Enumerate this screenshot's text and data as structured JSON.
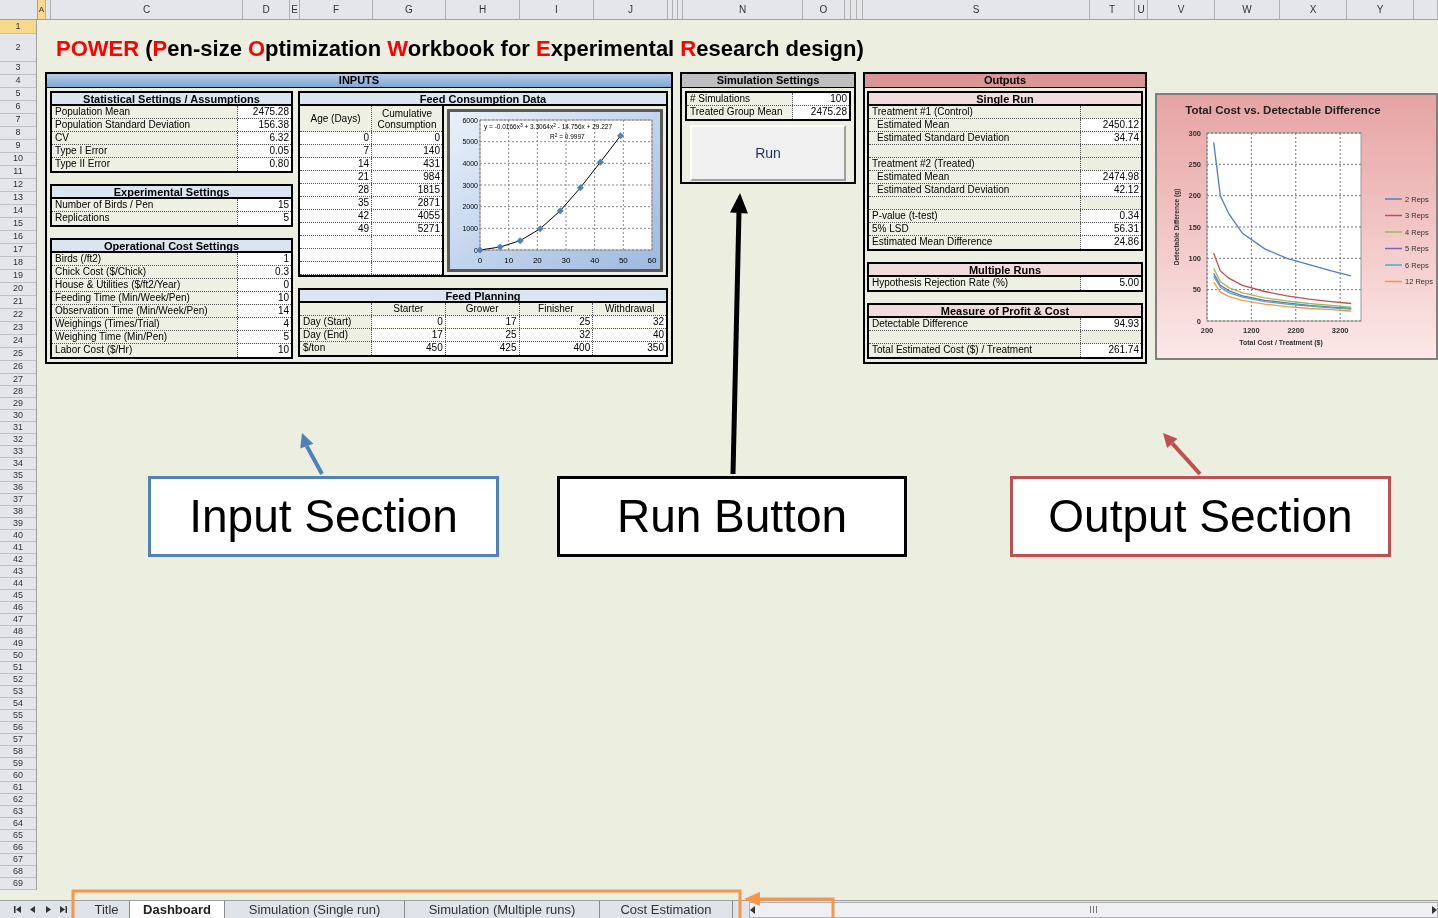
{
  "column_headers": [
    "A",
    "C",
    "D",
    "E",
    "F",
    "G",
    "H",
    "I",
    "J",
    "N",
    "O",
    "S",
    "T",
    "U",
    "V",
    "W",
    "X",
    "Y"
  ],
  "row_headers": [
    "1",
    "2",
    "3",
    "4",
    "5",
    "6",
    "7",
    "8",
    "9",
    "10",
    "11",
    "12",
    "13",
    "14",
    "15",
    "16",
    "17",
    "18",
    "19",
    "20",
    "21",
    "22",
    "23",
    "24",
    "25",
    "26",
    "27",
    "28",
    "29",
    "30",
    "31",
    "32",
    "33",
    "34",
    "35",
    "36",
    "37",
    "38",
    "39",
    "40",
    "41",
    "42",
    "43",
    "44",
    "45",
    "46",
    "47",
    "48",
    "49",
    "50",
    "51",
    "52",
    "53",
    "54",
    "55",
    "56",
    "57",
    "58",
    "59",
    "60",
    "61",
    "62",
    "63",
    "64",
    "65",
    "66",
    "67",
    "68",
    "69"
  ],
  "title": [
    {
      "text": "P",
      "accent": true
    },
    {
      "text": "OWER",
      "accent": true
    },
    {
      "text": " (",
      "accent": false
    },
    {
      "text": "P",
      "accent": true
    },
    {
      "text": "en-size ",
      "accent": false
    },
    {
      "text": "O",
      "accent": true
    },
    {
      "text": "ptimization ",
      "accent": false
    },
    {
      "text": "W",
      "accent": true
    },
    {
      "text": "orkbook for ",
      "accent": false
    },
    {
      "text": "E",
      "accent": true
    },
    {
      "text": "xperimental ",
      "accent": false
    },
    {
      "text": "R",
      "accent": true
    },
    {
      "text": "esearch design)",
      "accent": false
    }
  ],
  "inputs": {
    "title": "INPUTS",
    "tables": [
      {
        "title": "Statistical Settings / Assumptions",
        "rows": [
          {
            "label": "Population Mean",
            "value": "2475.28"
          },
          {
            "label": "Population Standard Deviation",
            "value": "156.38"
          },
          {
            "label": "CV",
            "value": "6.32"
          },
          {
            "label": "Type I Error",
            "value": "0.05"
          },
          {
            "label": "Type II Error",
            "value": "0.80"
          }
        ]
      },
      {
        "title": "Experimental Settings",
        "rows": [
          {
            "label": "Number of Birds / Pen",
            "value": "15"
          },
          {
            "label": "Replications",
            "value": "5"
          }
        ]
      },
      {
        "title": "Operational Cost Settings",
        "rows": [
          {
            "label": "Birds (/ft2)",
            "value": "1"
          },
          {
            "label": "Chick Cost ($/Chick)",
            "value": "0.3"
          },
          {
            "label": "House & Utilities ($/ft2/Year)",
            "value": "0"
          },
          {
            "label": "Feeding Time (Min/Week/Pen)",
            "value": "10"
          },
          {
            "label": "Observation Time (Min/Week/Pen)",
            "value": "14"
          },
          {
            "label": "Weighings (Times/Trial)",
            "value": "4"
          },
          {
            "label": "Weighing Time (Min/Pen)",
            "value": "5"
          },
          {
            "label": "Labor Cost ($/Hr)",
            "value": "10"
          }
        ]
      }
    ],
    "feed_consumption": {
      "title": "Feed Consumption Data",
      "columns": [
        "Age (Days)",
        "Cumulative Consumption"
      ],
      "rows": [
        [
          "0",
          "0"
        ],
        [
          "7",
          "140"
        ],
        [
          "14",
          "431"
        ],
        [
          "21",
          "984"
        ],
        [
          "28",
          "1815"
        ],
        [
          "35",
          "2871"
        ],
        [
          "42",
          "4055"
        ],
        [
          "49",
          "5271"
        ]
      ],
      "chart_data": {
        "type": "line",
        "grid": true,
        "x": [
          0,
          7,
          14,
          21,
          28,
          35,
          42,
          49
        ],
        "series": [
          {
            "color": "#4f81bd",
            "marker": "diamond",
            "values": [
              0,
              140,
              431,
              984,
              1815,
              2871,
              4055,
              5271
            ]
          }
        ],
        "xlim": [
          0,
          60
        ],
        "ylim": [
          0,
          6000
        ],
        "xticks": [
          0,
          10,
          20,
          30,
          40,
          50,
          60
        ],
        "yticks": [
          0,
          1000,
          2000,
          3000,
          4000,
          5000,
          6000
        ],
        "annotations": [
          "y = -0.0166x$^{3}$ + 3.3064x$^{2}$ - 14.756x + 29.227",
          "R$^{2}$ = 0.9997"
        ]
      }
    },
    "feed_planning": {
      "title": "Feed Planning",
      "columns": [
        "Starter",
        "Grower",
        "Finisher",
        "Withdrawal"
      ],
      "rows": [
        {
          "label": "Day (Start)",
          "values": [
            "0",
            "17",
            "25",
            "32"
          ]
        },
        {
          "label": "Day (End)",
          "values": [
            "17",
            "25",
            "32",
            "40"
          ]
        },
        {
          "label": "$/ton",
          "values": [
            "450",
            "425",
            "400",
            "350"
          ]
        }
      ]
    }
  },
  "simulation": {
    "title": "Simulation Settings",
    "rows": [
      {
        "label": "# Simulations",
        "value": "100"
      },
      {
        "label": "Treated Group Mean",
        "value": "2475.28"
      }
    ],
    "run_button": "Run"
  },
  "outputs": {
    "title": "Outputs",
    "sections": [
      {
        "title": "Single Run",
        "rows": [
          {
            "label": "Treatment #1 (Control)",
            "spaced": false,
            "children": [
              {
                "label": "Estimated Mean",
                "value": "2450.12"
              },
              {
                "label": "Estimated Standard Deviation",
                "value": "34.74"
              }
            ]
          },
          {
            "label": "Treatment #2 (Treated)",
            "spaced": true,
            "children": [
              {
                "label": "Estimated Mean",
                "value": "2474.98"
              },
              {
                "label": "Estimated Standard Deviation",
                "value": "42.12"
              }
            ]
          },
          {
            "label": "P-value (t-test)",
            "value": "0.34",
            "spaced": true
          },
          {
            "label": "5% LSD",
            "value": "56.31",
            "spaced": false
          },
          {
            "label": "Estimated Mean Difference",
            "value": "24.86",
            "spaced": false
          }
        ]
      },
      {
        "title": "Multiple Runs",
        "rows": [
          {
            "label": "Hypothesis Rejection Rate (%)",
            "value": "5.00",
            "spaced": false
          }
        ]
      },
      {
        "title": "Measure of Profit & Cost",
        "rows": [
          {
            "label": "Detectable Difference",
            "value": "94.93",
            "spaced": false
          },
          {
            "label": "Total Estimated Cost ($) / Treatment",
            "value": "261.74",
            "spaced": true
          }
        ]
      }
    ]
  },
  "cost_chart": {
    "chart_data": {
      "type": "line",
      "grid": true,
      "legend": "right",
      "title": "Total Cost vs. Detectable Difference",
      "xlabel": "Total Cost / Treatment ($)",
      "ylabel": "Detectable Difference (g)",
      "x": [
        350,
        500,
        700,
        1000,
        1500,
        2000,
        2500,
        3000,
        3450
      ],
      "xlim": [
        200,
        3670
      ],
      "ylim": [
        0,
        300
      ],
      "xticks": [
        200,
        1200,
        2200,
        3200
      ],
      "yticks": [
        0,
        50,
        100,
        150,
        200,
        250,
        300
      ],
      "series": [
        {
          "name": "2 Reps",
          "color": "#4f81bd",
          "values": [
            285,
            200,
            170,
            140,
            115,
            100,
            90,
            80,
            72
          ]
        },
        {
          "name": "3 Reps",
          "color": "#c0504d",
          "values": [
            108,
            80,
            68,
            57,
            47,
            40,
            35,
            31,
            28
          ]
        },
        {
          "name": "4 Reps",
          "color": "#9bbb59",
          "values": [
            84,
            63,
            53,
            45,
            37,
            32,
            28,
            25,
            22
          ]
        },
        {
          "name": "5 Reps",
          "color": "#8064a2",
          "values": [
            76,
            57,
            48,
            40,
            33,
            29,
            25,
            22,
            20
          ]
        },
        {
          "name": "6 Reps",
          "color": "#4bacc6",
          "values": [
            72,
            54,
            45,
            38,
            31,
            27,
            24,
            21,
            19
          ]
        },
        {
          "name": "12 Reps",
          "color": "#f79646",
          "values": [
            62,
            46,
            39,
            33,
            27,
            23,
            20,
            18,
            16
          ]
        }
      ]
    }
  },
  "annotations": [
    {
      "text": "Input Section",
      "color": "#4f81bd"
    },
    {
      "text": "Run Button",
      "color": "#000000"
    },
    {
      "text": "Output Section",
      "color": "#c0504d"
    }
  ],
  "sheet_tabs": [
    {
      "label": "Title",
      "selected": false
    },
    {
      "label": "Dashboard",
      "selected": true
    },
    {
      "label": "Simulation (Single run)",
      "selected": false
    },
    {
      "label": "Simulation (Multiple runs)",
      "selected": false
    },
    {
      "label": "Cost Estimation",
      "selected": false
    }
  ]
}
